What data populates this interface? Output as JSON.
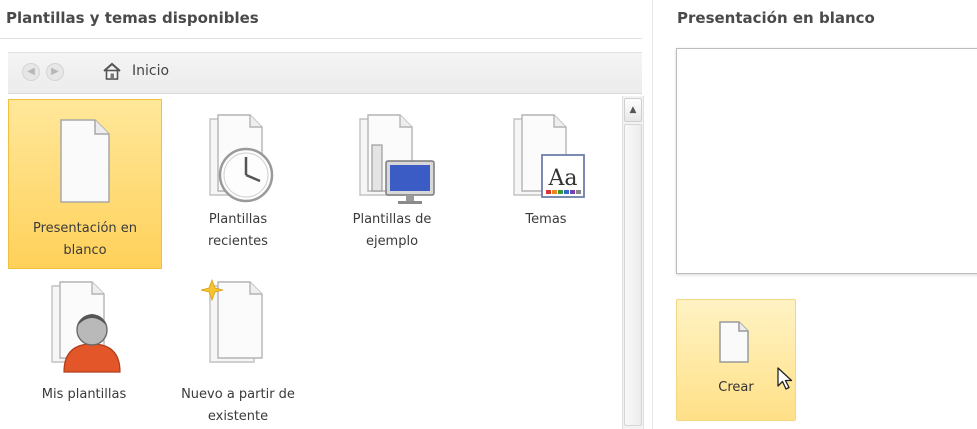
{
  "left_panel": {
    "title": "Plantillas y temas disponibles",
    "nav": {
      "back_glyph": "◀",
      "forward_glyph": "▶",
      "home_label": "Inicio"
    },
    "tiles": [
      {
        "label": "Presentación en\nblanco",
        "icon": "blank-document-icon",
        "selected": true
      },
      {
        "label": "Plantillas\nrecientes",
        "icon": "clock-document-icon",
        "selected": false
      },
      {
        "label": "Plantillas de\nejemplo",
        "icon": "monitor-document-icon",
        "selected": false
      },
      {
        "label": "Temas",
        "icon": "themes-aa-icon",
        "selected": false
      },
      {
        "label": "Mis plantillas",
        "icon": "user-document-icon",
        "selected": false
      },
      {
        "label": "Nuevo a partir de\nexistente",
        "icon": "new-from-existing-icon",
        "selected": false
      }
    ]
  },
  "right_panel": {
    "title": "Presentación en blanco",
    "create_label": "Crear"
  },
  "colors": {
    "selection": "#ffd15a",
    "monitor_screen": "#3b5cc4",
    "user_shirt": "#e2562a"
  }
}
